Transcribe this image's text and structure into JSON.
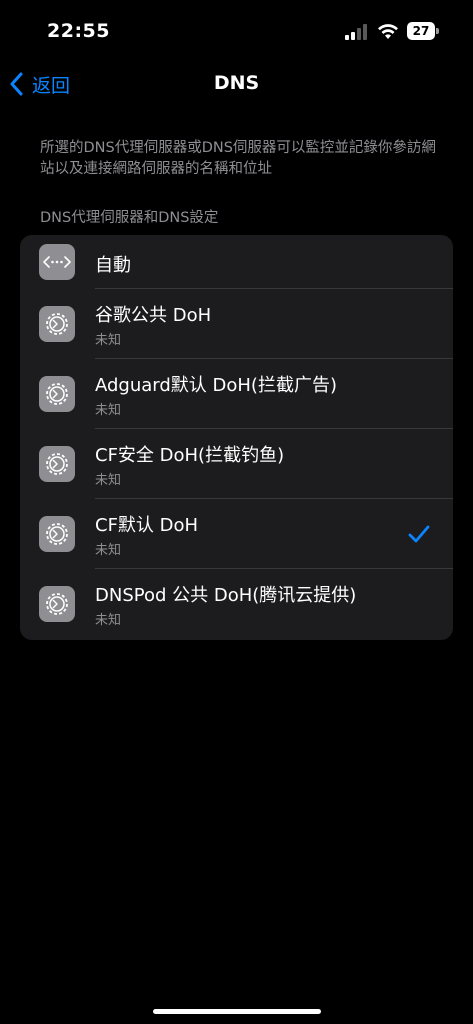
{
  "status_bar": {
    "time": "22:55",
    "battery_level": "27",
    "icons": [
      "cellular-signal-icon",
      "wifi-icon",
      "battery-icon"
    ]
  },
  "nav": {
    "back_label": "返回",
    "title": "DNS"
  },
  "description": "所選的DNS代理伺服器或DNS伺服器可以監控並記錄你參訪網站以及連接網路伺服器的名稱和位址",
  "section_header": "DNS代理伺服器和DNS設定",
  "list": {
    "items": [
      {
        "title": "自動",
        "subtitle": "",
        "icon": "ellipsis-arrows-icon",
        "selected": false
      },
      {
        "title": "谷歌公共 DoH",
        "subtitle": "未知",
        "icon": "gear-icon",
        "selected": false
      },
      {
        "title": "Adguard默认 DoH(拦截广告)",
        "subtitle": "未知",
        "icon": "gear-icon",
        "selected": false
      },
      {
        "title": "CF安全 DoH(拦截钓鱼)",
        "subtitle": "未知",
        "icon": "gear-icon",
        "selected": false
      },
      {
        "title": "CF默认 DoH",
        "subtitle": "未知",
        "icon": "gear-icon",
        "selected": true
      },
      {
        "title": "DNSPod 公共 DoH(腾讯云提供)",
        "subtitle": "未知",
        "icon": "gear-icon",
        "selected": false
      }
    ]
  },
  "colors": {
    "accent": "#0a84ff",
    "background": "#000000",
    "group_background": "#1c1c1e",
    "secondary_text": "#8e8e93",
    "icon_background": "#8e8e93"
  }
}
